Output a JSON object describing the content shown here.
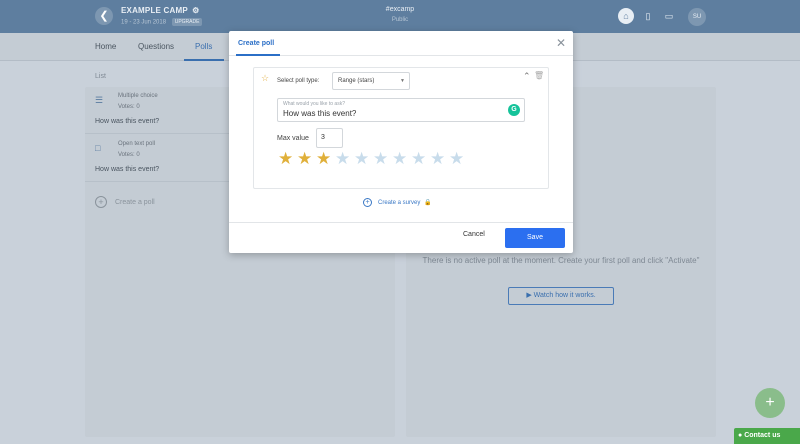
{
  "topbar": {
    "event_title": "EXAMPLE CAMP",
    "event_dates": "19 - 23 Jun 2018",
    "upgrade_badge": "UPGRADE",
    "event_code": "#excamp",
    "visibility": "Public",
    "avatar_initials": "SU"
  },
  "nav": {
    "tabs": [
      {
        "label": "Home"
      },
      {
        "label": "Questions"
      },
      {
        "label": "Polls"
      }
    ],
    "active_tab": "Polls"
  },
  "left_panel": {
    "label": "List",
    "polls": [
      {
        "type": "Multiple choice",
        "votes": "Votes: 0",
        "question": "How was this event?",
        "icon": "bar-chart-icon"
      },
      {
        "type": "Open text poll",
        "votes": "Votes: 0",
        "question": "How was this event?",
        "icon": "chat-icon"
      }
    ],
    "create_poll": "Create a poll"
  },
  "right_panel": {
    "no_poll_text": "There is no active poll at the moment. Create your first poll and click \"Activate\"",
    "watch_button": "Watch how it works."
  },
  "modal": {
    "title": "Create poll",
    "poll_type_label": "Select poll type:",
    "poll_type_value": "Range (stars)",
    "question_placeholder": "What would you like to ask?",
    "question_value": "How was this event?",
    "max_value_label": "Max value",
    "max_value": "3",
    "stars_total": 10,
    "stars_filled": 3,
    "create_survey": "Create a survey",
    "cancel_label": "Cancel",
    "save_label": "Save"
  },
  "contact_us": "Contact us",
  "colors": {
    "accent": "#2b6ff0",
    "star_filled": "#e0b03a",
    "star_empty": "#c8dceb",
    "topbar": "#5e7e9f"
  }
}
